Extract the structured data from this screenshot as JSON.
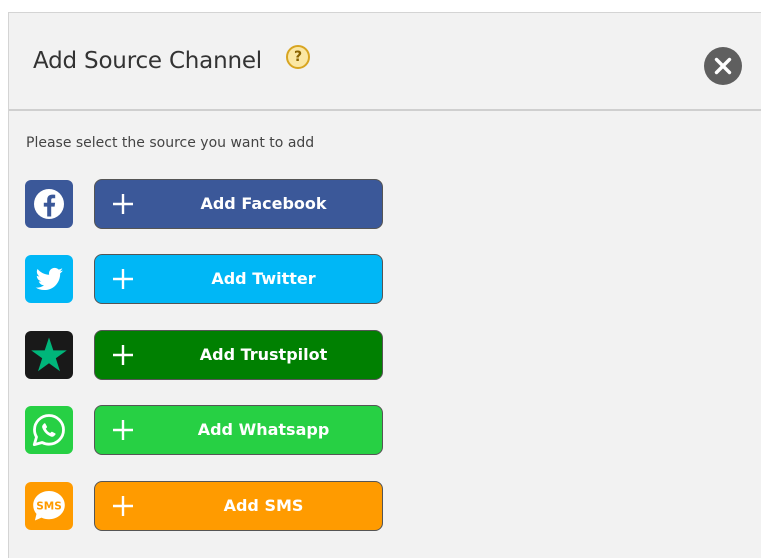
{
  "dialog": {
    "title": "Add Source Channel",
    "help_glyph": "?",
    "close_icon": "close-icon",
    "instruction": "Please select the source you want to add"
  },
  "sources": [
    {
      "id": "facebook",
      "label": "Add Facebook",
      "icon": "facebook-icon",
      "color": "#3b5899"
    },
    {
      "id": "twitter",
      "label": "Add Twitter",
      "icon": "twitter-icon",
      "color": "#00b7f6"
    },
    {
      "id": "trustpilot",
      "label": "Add Trustpilot",
      "icon": "trustpilot-icon",
      "color": "#008001"
    },
    {
      "id": "whatsapp",
      "label": "Add Whatsapp",
      "icon": "whatsapp-icon",
      "color": "#27d044"
    },
    {
      "id": "sms",
      "label": "Add SMS",
      "icon": "sms-icon",
      "color": "#ff9b00"
    }
  ],
  "sms_icon_text": "SMS"
}
